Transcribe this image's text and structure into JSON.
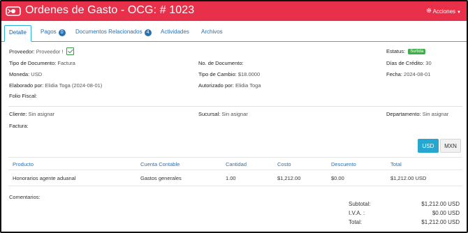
{
  "header": {
    "title": "Ordenes de Gasto - OCG: # 1023",
    "actions_label": "Acciones",
    "color": "#e9304a"
  },
  "tabs": [
    {
      "label": "Detalle",
      "badge": ""
    },
    {
      "label": "Pagos",
      "badge": "0"
    },
    {
      "label": "Documentos Relacionados",
      "badge": "4"
    },
    {
      "label": "Actividades",
      "badge": ""
    },
    {
      "label": "Archivos",
      "badge": ""
    }
  ],
  "info": {
    "proveedor_label": "Proveedor:",
    "proveedor_value": "Proveedor !",
    "tipo_doc_label": "Tipo de Documento:",
    "tipo_doc_value": "Factura",
    "moneda_label": "Moneda:",
    "moneda_value": "USD",
    "elaborado_label": "Elaborado por:",
    "elaborado_value": "Elidia Toga (2024-08-01)",
    "folio_label": "Folio Fiscal:",
    "folio_value": "",
    "no_doc_label": "No. de Documento:",
    "no_doc_value": "",
    "tipo_cambio_label": "Tipo de Cambio:",
    "tipo_cambio_value": "$18.0000",
    "autorizado_label": "Autorizado por:",
    "autorizado_value": "Elidia Toga",
    "estatus_label": "Estatus:",
    "estatus_value": "Surtida",
    "dias_credito_label": "Días de Crédito:",
    "dias_credito_value": "30",
    "fecha_label": "Fecha:",
    "fecha_value": "2024-08-01",
    "cliente_label": "Cliente:",
    "cliente_value": "Sin asignar",
    "sucursal_label": "Sucursal:",
    "sucursal_value": "Sin asignar",
    "departamento_label": "Departamento:",
    "departamento_value": "Sin asignar",
    "factura_label": "Factura:",
    "factura_value": ""
  },
  "currency_toggle": {
    "usd": "USD",
    "mxn": "MXN",
    "selected": "USD",
    "active_color": "#27a6cf"
  },
  "table": {
    "headers": [
      "Producto",
      "Cuenta Contable",
      "Cantidad",
      "Costo",
      "Descuento",
      "Total"
    ],
    "rows": [
      [
        "Honorarios agente aduanal",
        "Gastos generales",
        "1.00",
        "$1,212.00",
        "$0.00",
        "$1,212.00 USD"
      ]
    ]
  },
  "comments_label": "Comentarios:",
  "totals": {
    "subtotal_label": "Subtotal:",
    "subtotal_value": "$1,212.00 USD",
    "iva_label": "I.V.A. :",
    "iva_value": "$0.00 USD",
    "total_label": "Total:",
    "total_value": "$1,212.00 USD"
  }
}
